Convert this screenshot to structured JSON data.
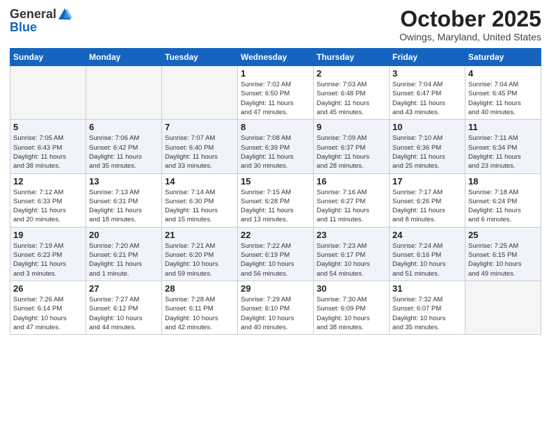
{
  "header": {
    "logo_general": "General",
    "logo_blue": "Blue",
    "month_title": "October 2025",
    "location": "Owings, Maryland, United States"
  },
  "weekdays": [
    "Sunday",
    "Monday",
    "Tuesday",
    "Wednesday",
    "Thursday",
    "Friday",
    "Saturday"
  ],
  "weeks": [
    [
      {
        "day": "",
        "info": ""
      },
      {
        "day": "",
        "info": ""
      },
      {
        "day": "",
        "info": ""
      },
      {
        "day": "1",
        "info": "Sunrise: 7:02 AM\nSunset: 6:50 PM\nDaylight: 11 hours\nand 47 minutes."
      },
      {
        "day": "2",
        "info": "Sunrise: 7:03 AM\nSunset: 6:48 PM\nDaylight: 11 hours\nand 45 minutes."
      },
      {
        "day": "3",
        "info": "Sunrise: 7:04 AM\nSunset: 6:47 PM\nDaylight: 11 hours\nand 43 minutes."
      },
      {
        "day": "4",
        "info": "Sunrise: 7:04 AM\nSunset: 6:45 PM\nDaylight: 11 hours\nand 40 minutes."
      }
    ],
    [
      {
        "day": "5",
        "info": "Sunrise: 7:05 AM\nSunset: 6:43 PM\nDaylight: 11 hours\nand 38 minutes."
      },
      {
        "day": "6",
        "info": "Sunrise: 7:06 AM\nSunset: 6:42 PM\nDaylight: 11 hours\nand 35 minutes."
      },
      {
        "day": "7",
        "info": "Sunrise: 7:07 AM\nSunset: 6:40 PM\nDaylight: 11 hours\nand 33 minutes."
      },
      {
        "day": "8",
        "info": "Sunrise: 7:08 AM\nSunset: 6:39 PM\nDaylight: 11 hours\nand 30 minutes."
      },
      {
        "day": "9",
        "info": "Sunrise: 7:09 AM\nSunset: 6:37 PM\nDaylight: 11 hours\nand 28 minutes."
      },
      {
        "day": "10",
        "info": "Sunrise: 7:10 AM\nSunset: 6:36 PM\nDaylight: 11 hours\nand 25 minutes."
      },
      {
        "day": "11",
        "info": "Sunrise: 7:11 AM\nSunset: 6:34 PM\nDaylight: 11 hours\nand 23 minutes."
      }
    ],
    [
      {
        "day": "12",
        "info": "Sunrise: 7:12 AM\nSunset: 6:33 PM\nDaylight: 11 hours\nand 20 minutes."
      },
      {
        "day": "13",
        "info": "Sunrise: 7:13 AM\nSunset: 6:31 PM\nDaylight: 11 hours\nand 18 minutes."
      },
      {
        "day": "14",
        "info": "Sunrise: 7:14 AM\nSunset: 6:30 PM\nDaylight: 11 hours\nand 15 minutes."
      },
      {
        "day": "15",
        "info": "Sunrise: 7:15 AM\nSunset: 6:28 PM\nDaylight: 11 hours\nand 13 minutes."
      },
      {
        "day": "16",
        "info": "Sunrise: 7:16 AM\nSunset: 6:27 PM\nDaylight: 11 hours\nand 11 minutes."
      },
      {
        "day": "17",
        "info": "Sunrise: 7:17 AM\nSunset: 6:26 PM\nDaylight: 11 hours\nand 8 minutes."
      },
      {
        "day": "18",
        "info": "Sunrise: 7:18 AM\nSunset: 6:24 PM\nDaylight: 11 hours\nand 6 minutes."
      }
    ],
    [
      {
        "day": "19",
        "info": "Sunrise: 7:19 AM\nSunset: 6:23 PM\nDaylight: 11 hours\nand 3 minutes."
      },
      {
        "day": "20",
        "info": "Sunrise: 7:20 AM\nSunset: 6:21 PM\nDaylight: 11 hours\nand 1 minute."
      },
      {
        "day": "21",
        "info": "Sunrise: 7:21 AM\nSunset: 6:20 PM\nDaylight: 10 hours\nand 59 minutes."
      },
      {
        "day": "22",
        "info": "Sunrise: 7:22 AM\nSunset: 6:19 PM\nDaylight: 10 hours\nand 56 minutes."
      },
      {
        "day": "23",
        "info": "Sunrise: 7:23 AM\nSunset: 6:17 PM\nDaylight: 10 hours\nand 54 minutes."
      },
      {
        "day": "24",
        "info": "Sunrise: 7:24 AM\nSunset: 6:16 PM\nDaylight: 10 hours\nand 51 minutes."
      },
      {
        "day": "25",
        "info": "Sunrise: 7:25 AM\nSunset: 6:15 PM\nDaylight: 10 hours\nand 49 minutes."
      }
    ],
    [
      {
        "day": "26",
        "info": "Sunrise: 7:26 AM\nSunset: 6:14 PM\nDaylight: 10 hours\nand 47 minutes."
      },
      {
        "day": "27",
        "info": "Sunrise: 7:27 AM\nSunset: 6:12 PM\nDaylight: 10 hours\nand 44 minutes."
      },
      {
        "day": "28",
        "info": "Sunrise: 7:28 AM\nSunset: 6:11 PM\nDaylight: 10 hours\nand 42 minutes."
      },
      {
        "day": "29",
        "info": "Sunrise: 7:29 AM\nSunset: 6:10 PM\nDaylight: 10 hours\nand 40 minutes."
      },
      {
        "day": "30",
        "info": "Sunrise: 7:30 AM\nSunset: 6:09 PM\nDaylight: 10 hours\nand 38 minutes."
      },
      {
        "day": "31",
        "info": "Sunrise: 7:32 AM\nSunset: 6:07 PM\nDaylight: 10 hours\nand 35 minutes."
      },
      {
        "day": "",
        "info": ""
      }
    ]
  ]
}
